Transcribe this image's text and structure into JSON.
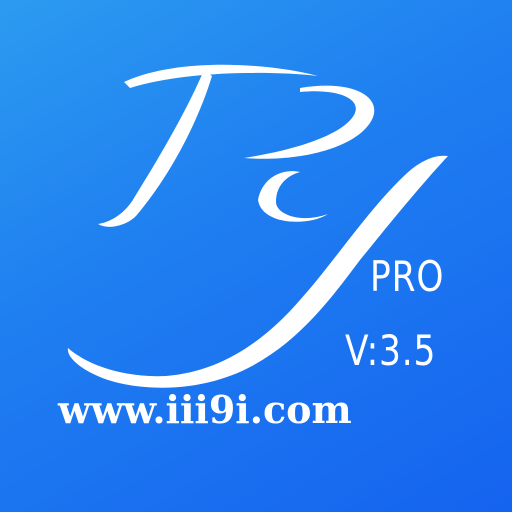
{
  "app_icon": {
    "background_color_top": "#2c9bf0",
    "background_color_bottom": "#1563ef",
    "foreground_color": "#ffffff",
    "monogram": "Py",
    "monogram_icon": "script-py-monogram-icon",
    "tier": "PRO",
    "version": "V:3.5",
    "website": "www.iii9i.com"
  }
}
